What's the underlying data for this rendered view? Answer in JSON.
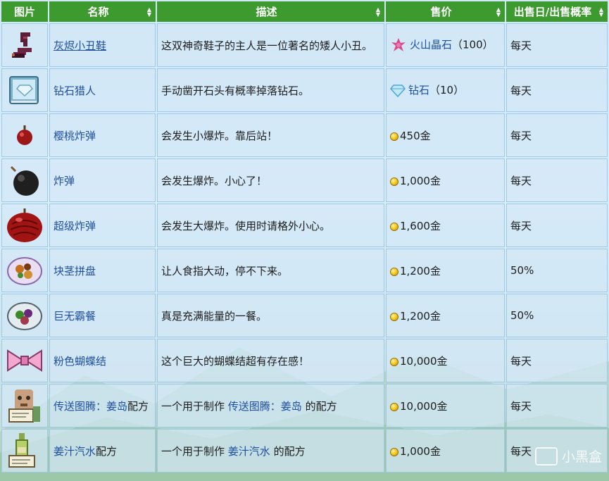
{
  "headers": {
    "image": "图片",
    "name": "名称",
    "description": "描述",
    "price": "售价",
    "schedule": "出售日/出售概率"
  },
  "rows": [
    {
      "icon": "clown-shoes-icon",
      "name": "灰烬小丑鞋",
      "description": "这双神奇鞋子的主人是一位著名的矮人小丑。",
      "price_currency": "火山晶石",
      "price_amount": "（100）",
      "schedule": "每天"
    },
    {
      "icon": "diamond-hunter-book-icon",
      "name": "钻石猎人",
      "description": "手动凿开石头有概率掉落钻石。",
      "price_currency": "钻石",
      "price_amount": "（10）",
      "schedule": "每天"
    },
    {
      "icon": "cherry-bomb-icon",
      "name": "樱桃炸弹",
      "description": "会发生小爆炸。靠后站！",
      "price": "450金",
      "schedule": "每天"
    },
    {
      "icon": "bomb-icon",
      "name": "炸弹",
      "description": "会发生爆炸。小心了！",
      "price": "1,000金",
      "schedule": "每天"
    },
    {
      "icon": "mega-bomb-icon",
      "name": "超级炸弹",
      "description": "会发生大爆炸。使用时请格外小心。",
      "price": "1,600金",
      "schedule": "每天"
    },
    {
      "icon": "root-platter-icon",
      "name": "块茎拼盘",
      "description": "让人食指大动，停不下来。",
      "price": "1,200金",
      "schedule": "50%"
    },
    {
      "icon": "super-meal-icon",
      "name": "巨无霸餐",
      "description": "真是充满能量的一餐。",
      "price": "1,200金",
      "schedule": "50%"
    },
    {
      "icon": "pink-bow-icon",
      "name": "粉色蝴蝶结",
      "description": "这个巨大的蝴蝶结超有存在感！",
      "price": "10,000金",
      "schedule": "每天"
    },
    {
      "icon": "totem-recipe-icon",
      "name_link": "传送图腾：姜岛",
      "name_suffix": "配方",
      "desc_prefix": "一个用于制作 ",
      "desc_link": "传送图腾：姜岛",
      "desc_suffix": " 的配方",
      "price": "10,000金",
      "schedule": "每天"
    },
    {
      "icon": "ginger-ale-recipe-icon",
      "name_link": "姜汁汽水",
      "name_suffix": "配方",
      "desc_prefix": "一个用于制作 ",
      "desc_link": "姜汁汽水",
      "desc_suffix": " 的配方",
      "price": "1,000金",
      "schedule": "每天"
    }
  ],
  "watermark": "小黑盒",
  "colors": {
    "header_bg": "#3d9a2f",
    "link": "#1e4fa0",
    "row_bg": "#d2e8f7"
  }
}
